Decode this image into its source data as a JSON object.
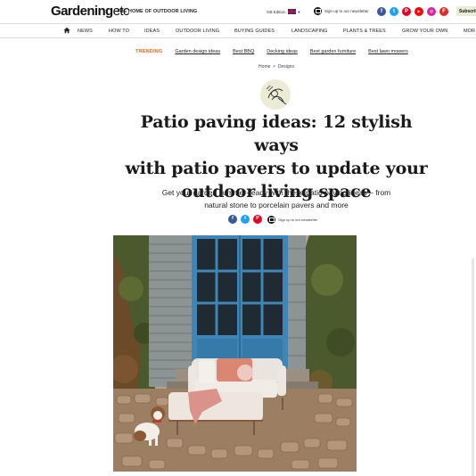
{
  "header": {
    "logo_main": "Gardening",
    "logo_suffix": "etc",
    "tagline": "THE HOME OF OUTDOOR LIVING",
    "edition": "GB Edition",
    "newsletter": "Sign up to our newsletter",
    "subscribe": "Subscribe",
    "social": [
      {
        "icon": "facebook-icon",
        "glyph": "f",
        "color": "#3b5998"
      },
      {
        "icon": "twitter-icon",
        "glyph": "t",
        "color": "#1da1f2"
      },
      {
        "icon": "pinterest-icon",
        "glyph": "P",
        "color": "#e60023"
      },
      {
        "icon": "youtube-icon",
        "glyph": "▶",
        "color": "#ff0000"
      },
      {
        "icon": "instagram-icon",
        "glyph": "◎",
        "color": "#d6249f"
      },
      {
        "icon": "flipboard-icon",
        "glyph": "F",
        "color": "#e12828"
      }
    ]
  },
  "nav": {
    "items": [
      "NEWS",
      "HOW TO",
      "IDEAS",
      "OUTDOOR LIVING",
      "BUYING GUIDES",
      "LANDSCAPING",
      "PLANTS & TREES",
      "GROW YOUR OWN",
      "MOR"
    ]
  },
  "trending": {
    "label": "TRENDING",
    "links": [
      "Garden design ideas",
      "Best BBQ",
      "Decking ideas",
      "Best garden furniture",
      "Best lawn mowers"
    ]
  },
  "breadcrumb": {
    "home": "Home",
    "separator": ">",
    "section": "Designs"
  },
  "article": {
    "title_lines": [
      "Patio paving ideas: 12 stylish ways",
      "with patio pavers to update your",
      "outdoor living space"
    ],
    "standfirst_lines": [
      "Get your garden summer-ready with these patio paving ideas – from",
      "natural stone to porcelain pavers and more"
    ]
  },
  "share": {
    "newsletter": "Sign up to our newsletter"
  },
  "colors": {
    "accent": "#e06a3a",
    "door_blue": "#3f86b6"
  }
}
